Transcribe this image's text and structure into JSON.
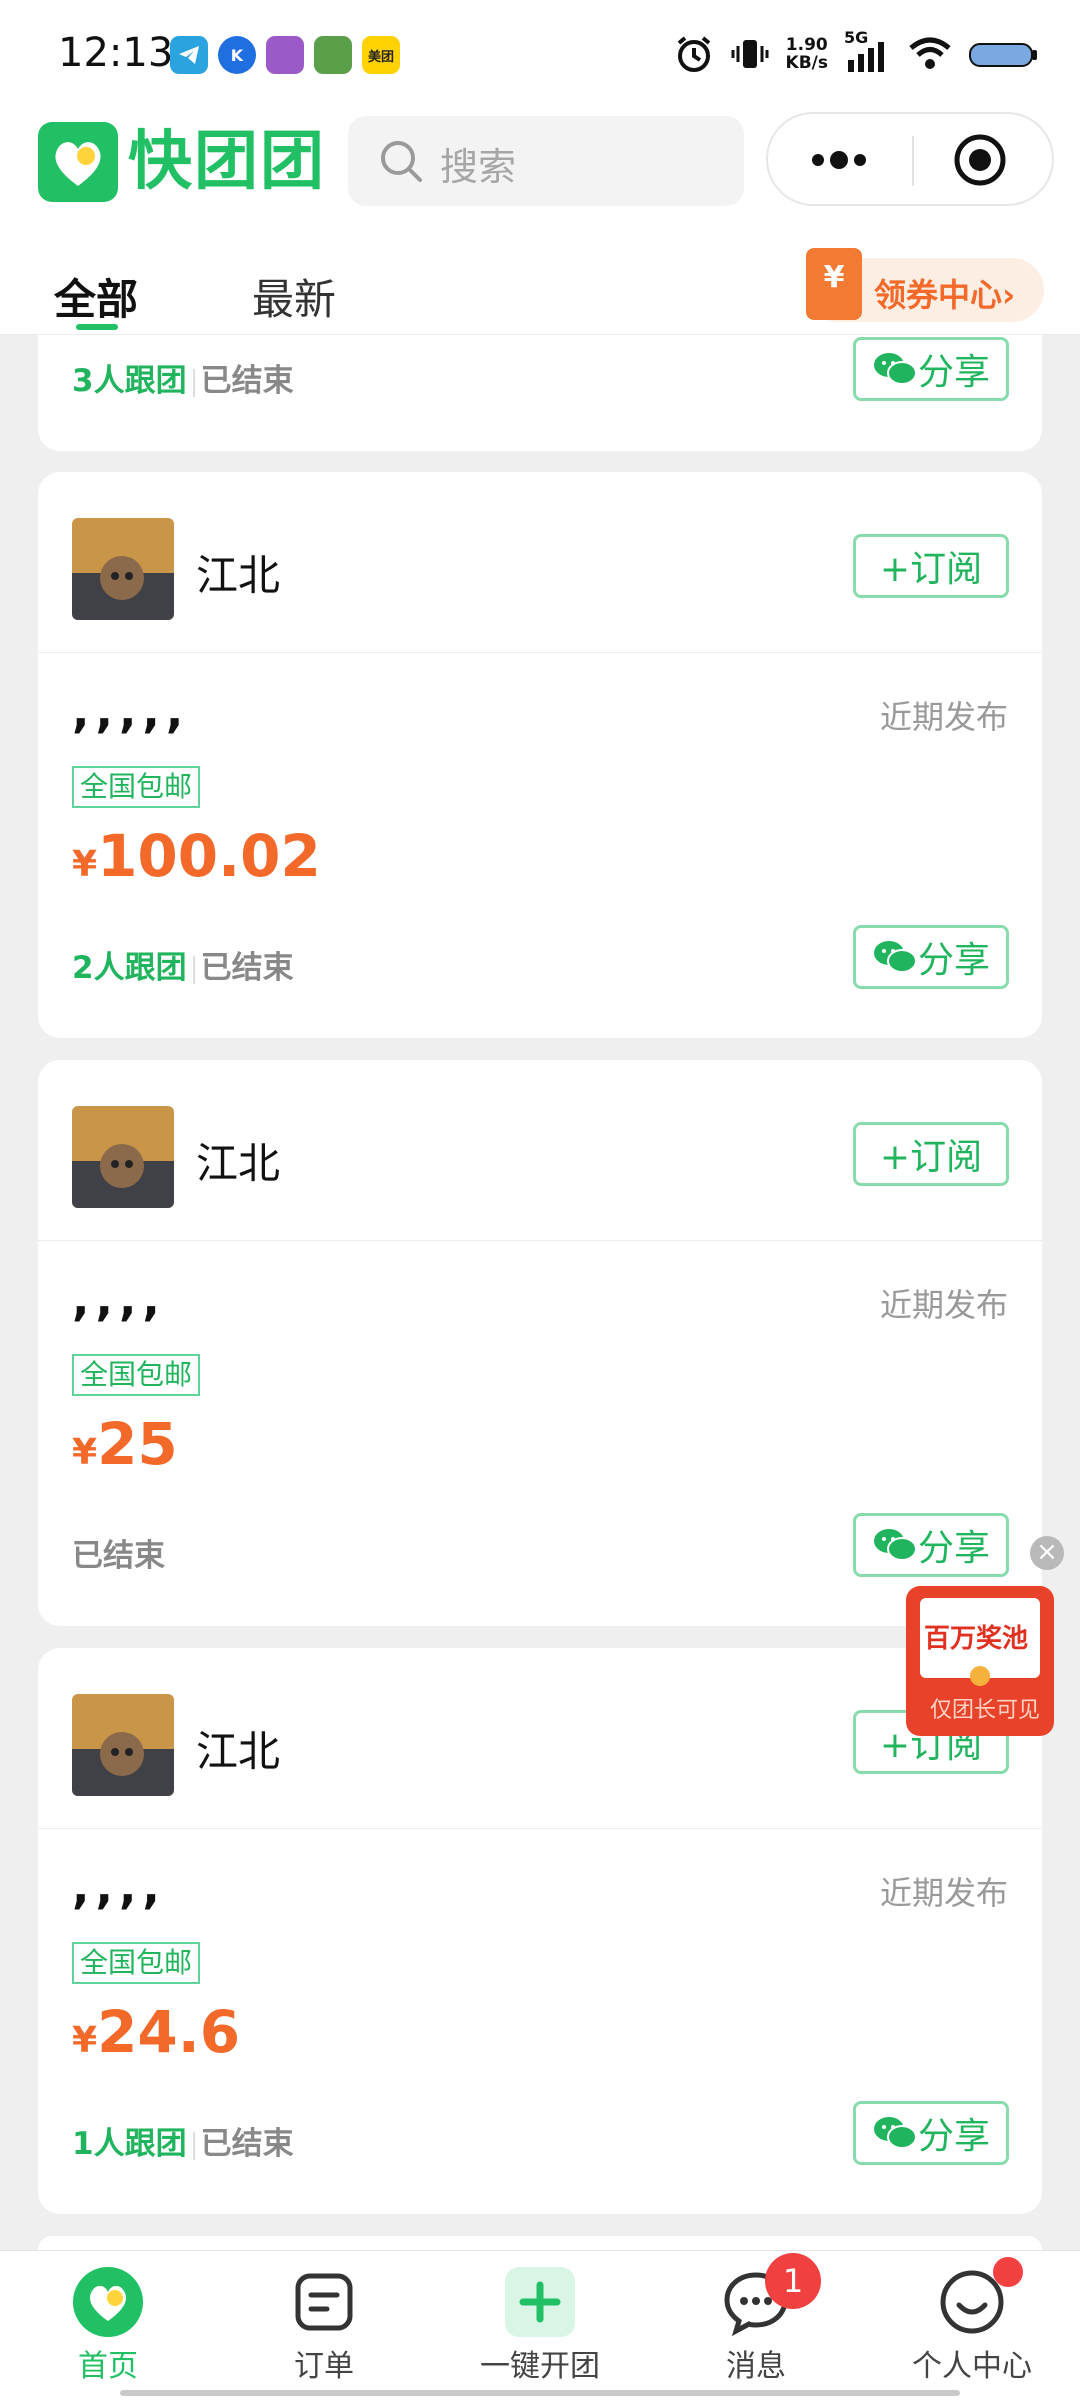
{
  "status_bar": {
    "time": "12:13",
    "speed_value": "1.90",
    "speed_unit": "KB/s",
    "network": "5G",
    "app_meituan": "美团"
  },
  "header": {
    "app_name": "快团团",
    "search_placeholder": "搜索"
  },
  "tabs": [
    {
      "label": "全部",
      "active": true
    },
    {
      "label": "最新",
      "active": false
    }
  ],
  "coupon": {
    "label": "领券中心",
    "icon": "¥",
    "chevron": "›"
  },
  "partial_card": {
    "group_count": "3人跟团",
    "status": "已结束",
    "share_label": "分享"
  },
  "cards": [
    {
      "author": "江北",
      "subscribe_label": "+订阅",
      "title": ",,,,,",
      "posted": "近期发布",
      "badge": "全国包邮",
      "currency": "¥",
      "price": "100.02",
      "group_count": "2人跟团",
      "status": "已结束",
      "share_label": "分享"
    },
    {
      "author": "江北",
      "subscribe_label": "+订阅",
      "title": ",,,,",
      "posted": "近期发布",
      "badge": "全国包邮",
      "currency": "¥",
      "price": "25",
      "group_count": "",
      "status": "已结束",
      "share_label": "分享"
    },
    {
      "author": "江北",
      "subscribe_label": "+订阅",
      "title": ",,,,",
      "posted": "近期发布",
      "badge": "全国包邮",
      "currency": "¥",
      "price": "24.6",
      "group_count": "1人跟团",
      "status": "已结束",
      "share_label": "分享"
    }
  ],
  "promo": {
    "title": "百万奖池",
    "subtitle": "仅团长可见",
    "close": "×"
  },
  "bottom_nav": [
    {
      "label": "首页",
      "icon": "home-icon",
      "active": true
    },
    {
      "label": "订单",
      "icon": "order-icon",
      "active": false
    },
    {
      "label": "一键开团",
      "icon": "plus-icon",
      "active": false
    },
    {
      "label": "消息",
      "icon": "chat-icon",
      "active": false,
      "badge": "1"
    },
    {
      "label": "个人中心",
      "icon": "profile-icon",
      "active": false
    }
  ],
  "colors": {
    "brand_green": "#21c065",
    "price_orange": "#f2692a",
    "badge_red": "#f04040"
  }
}
